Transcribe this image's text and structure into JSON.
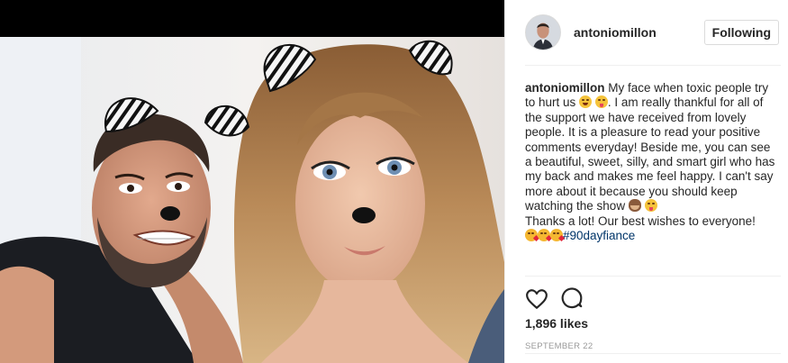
{
  "post": {
    "username": "antoniomillon",
    "follow_button": "Following",
    "caption": {
      "username": "antoniomillon",
      "part1": " My face when toxic people try to hurt us ",
      "part2": ". I am really thankful for all of the support we have received from lovely people. It is a pleasure to read your positive comments everyday! Beside me, you can see a beautiful, sweet, silly, and smart girl who has my back and makes me feel happy. I can't say more about it because you should keep watching the show ",
      "part3": "Thanks a lot! Our best wishes to everyone!",
      "hashtag": "#90dayfiance"
    },
    "icons": {
      "like": "heart-icon",
      "comment": "comment-icon"
    },
    "likes": "1,896 likes",
    "date": "September 22"
  },
  "colors": {
    "text": "#262626",
    "hashtag": "#003569",
    "border": "#dbdbdb",
    "muted": "#999999"
  }
}
